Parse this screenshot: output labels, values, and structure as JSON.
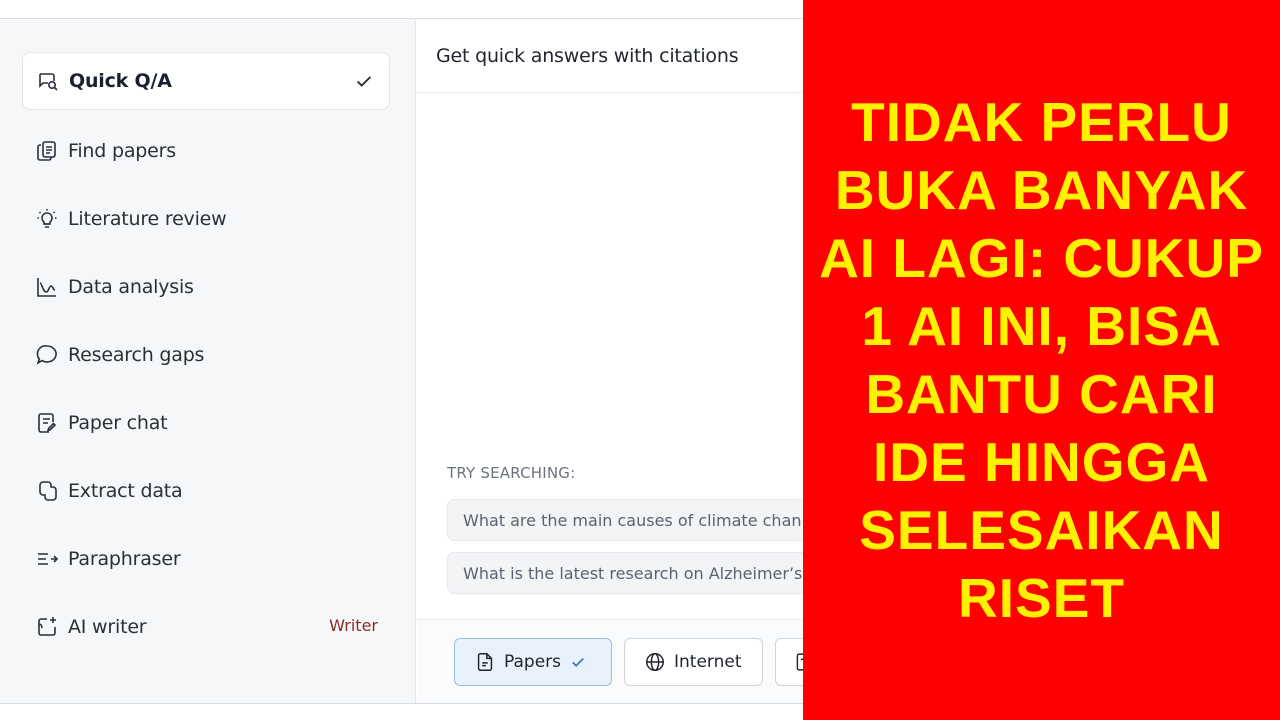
{
  "sidebar": {
    "items": [
      {
        "label": "Quick Q/A",
        "icon": "chat-search-icon",
        "active": true
      },
      {
        "label": "Find papers",
        "icon": "papers-icon"
      },
      {
        "label": "Literature review",
        "icon": "lightbulb-icon"
      },
      {
        "label": "Data analysis",
        "icon": "chart-line-icon"
      },
      {
        "label": "Research gaps",
        "icon": "chat-bubble-icon"
      },
      {
        "label": "Paper chat",
        "icon": "document-edit-icon"
      },
      {
        "label": "Extract data",
        "icon": "extract-icon"
      },
      {
        "label": "Paraphraser",
        "icon": "paraphrase-icon"
      },
      {
        "label": "AI writer",
        "icon": "writer-icon",
        "badge": "Writer"
      }
    ]
  },
  "main": {
    "title": "Get quick answers with citations",
    "try_label": "TRY SEARCHING:",
    "suggestions": [
      "What are the main causes of climate chan",
      "What is the latest research on Alzheimer’s"
    ],
    "sources": [
      {
        "label": "Papers",
        "selected": true
      },
      {
        "label": "Internet",
        "selected": false
      }
    ]
  },
  "banner": {
    "text": "TIDAK PERLU BUKA BANYAK AI LAGI: CUKUP 1 AI INI, BISA BANTU CARI IDE HINGGA SELESAIKAN RISET"
  },
  "colors": {
    "banner_bg": "#ff0000",
    "banner_text": "#fff200",
    "writer_badge": "#8a2b2b",
    "selected_source_bg": "#e9f1fc"
  }
}
